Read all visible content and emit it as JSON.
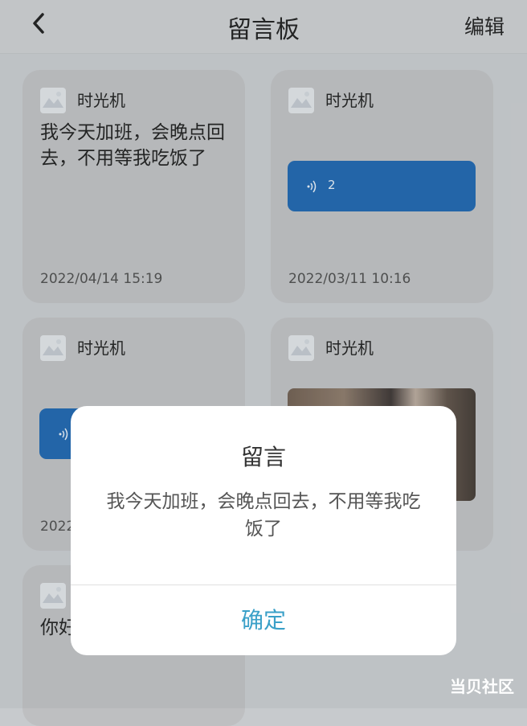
{
  "header": {
    "title": "留言板",
    "edit_label": "编辑",
    "back_icon": "chevron-left-icon"
  },
  "messages": [
    {
      "author": "时光机",
      "type": "text",
      "text": "我今天加班，会晚点回去，不用等我吃饭了",
      "time": "2022/04/14 15:19"
    },
    {
      "author": "时光机",
      "type": "voice",
      "voice_length": "2",
      "time": "2022/03/11 10:16"
    },
    {
      "author": "时光机",
      "type": "voice",
      "voice_length": "",
      "time": "2022"
    },
    {
      "author": "时光机",
      "type": "image",
      "time": ""
    },
    {
      "author": "",
      "type": "text",
      "text": "你好",
      "time": ""
    }
  ],
  "dialog": {
    "title": "留言",
    "message": "我今天加班，会晚点回去，不用等我吃饭了",
    "confirm_label": "确定"
  },
  "watermark": "当贝社区",
  "colors": {
    "voice_bubble": "#1a63ad",
    "confirm_text": "#3aa0c8",
    "card_bg": "#bebfc1"
  }
}
